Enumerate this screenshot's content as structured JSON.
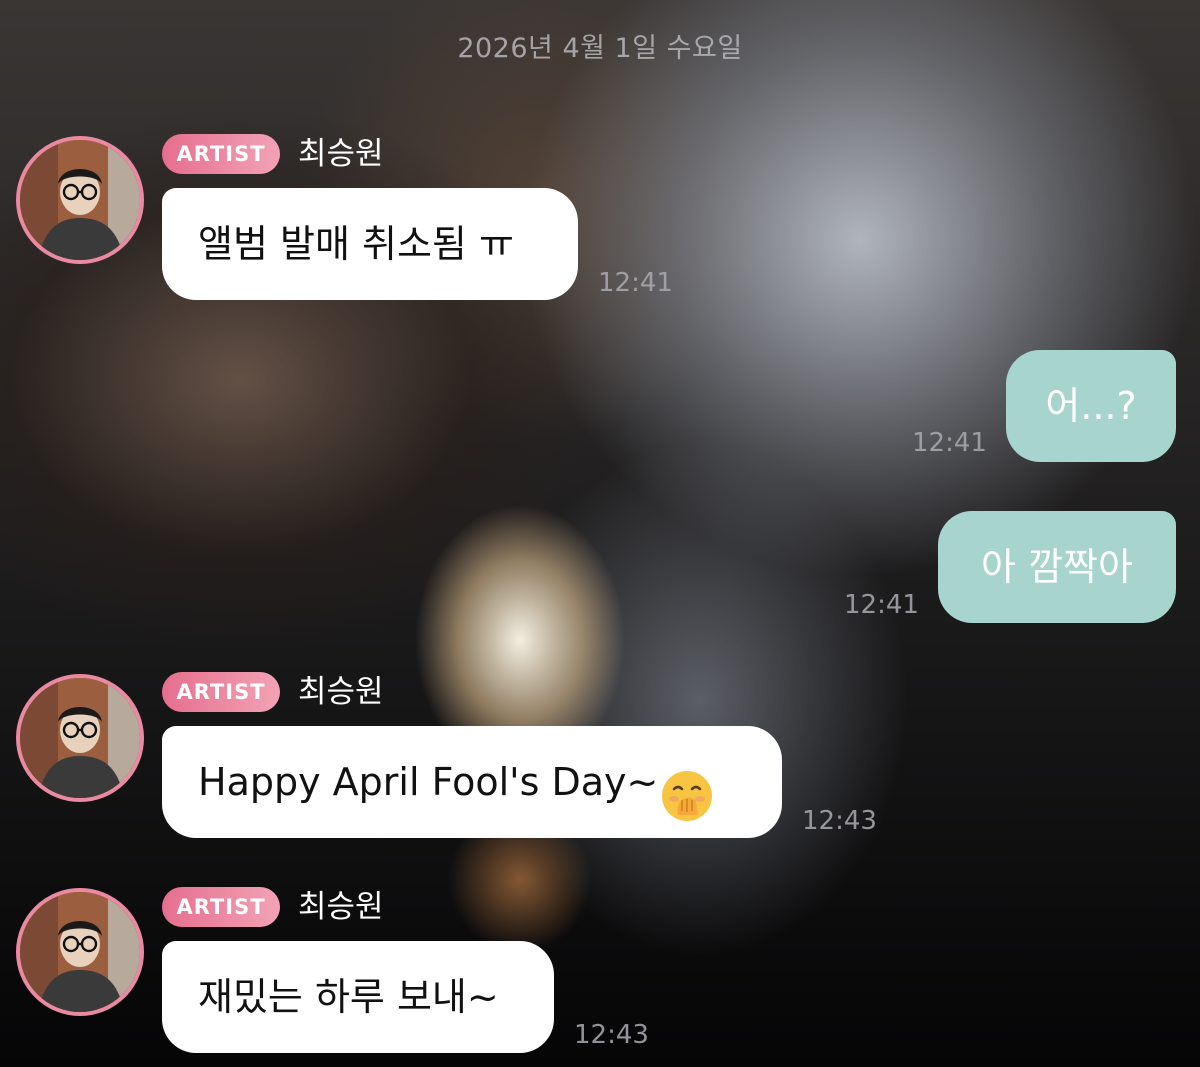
{
  "chat": {
    "date_separator": "2026년 4월 1일 수요일",
    "messages": [
      {
        "direction": "incoming",
        "badge": "ARTIST",
        "sender": "최승원",
        "text": "앨범 발매 취소됨 ㅠ",
        "time": "12:41"
      },
      {
        "direction": "outgoing",
        "text": "어...?",
        "time": "12:41"
      },
      {
        "direction": "outgoing",
        "text": "아 깜짝아",
        "time": "12:41"
      },
      {
        "direction": "incoming",
        "badge": "ARTIST",
        "sender": "최승원",
        "text": "Happy April Fool's Day~",
        "emoji": "face-with-hand-over-mouth-emoji",
        "time": "12:43"
      },
      {
        "direction": "incoming",
        "badge": "ARTIST",
        "sender": "최승원",
        "text": "재밌는 하루 보내~",
        "time": "12:43"
      }
    ]
  },
  "colors": {
    "incoming_bubble": "#ffffff",
    "outgoing_bubble": "#a7d4cc",
    "artist_badge_start": "#e66e8e",
    "artist_badge_end": "#f2a3b5",
    "avatar_ring": "#e98aa2"
  }
}
